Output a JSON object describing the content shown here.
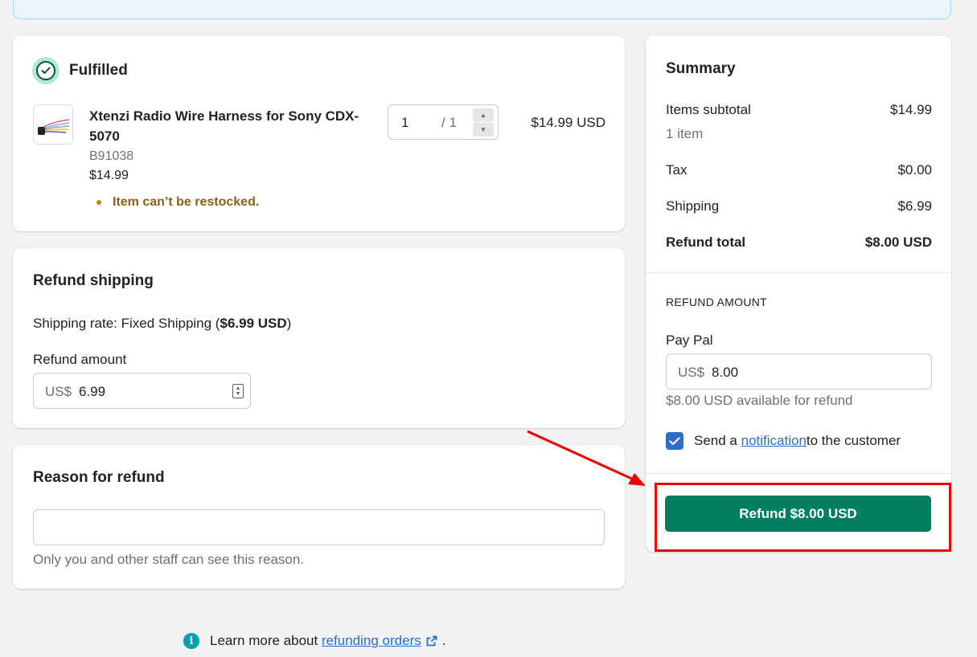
{
  "fulfilled": {
    "title": "Fulfilled",
    "item": {
      "name": "Xtenzi Radio Wire Harness for Sony CDX-5070",
      "sku": "B91038",
      "price": "$14.99",
      "quantity": "1",
      "quantity_max": "/ 1",
      "line_total": "$14.99 USD",
      "restock_note": "Item can’t be restocked."
    }
  },
  "refund_shipping": {
    "title": "Refund shipping",
    "rate_prefix": "Shipping rate: Fixed Shipping (",
    "rate_amount": "$6.99 USD",
    "rate_suffix": ")",
    "amount_label": "Refund amount",
    "currency_prefix": "US$",
    "amount_value": "6.99"
  },
  "reason": {
    "title": "Reason for refund",
    "value": "",
    "help": "Only you and other staff can see this reason."
  },
  "summary": {
    "title": "Summary",
    "items_subtotal_label": "Items subtotal",
    "items_subtotal_value": "$14.99",
    "items_count": "1 item",
    "tax_label": "Tax",
    "tax_value": "$0.00",
    "shipping_label": "Shipping",
    "shipping_value": "$6.99",
    "refund_total_label": "Refund total",
    "refund_total_value": "$8.00 USD",
    "refund_amount_heading": "REFUND AMOUNT",
    "gateway_label": "Pay Pal",
    "currency_prefix": "US$",
    "gateway_value": "8.00",
    "available_text": "$8.00 USD available for refund",
    "notify_prefix": "Send a ",
    "notify_link": "notification",
    "notify_suffix": " to the customer",
    "notify_checked": true,
    "refund_button": "Refund $8.00 USD"
  },
  "footer": {
    "prefix": "Learn more about ",
    "link": "refunding orders",
    "suffix": "."
  },
  "colors": {
    "primary_button": "#008060",
    "link": "#2c6ecb",
    "annotation": "#ee0000",
    "warning_text": "#8a6116"
  }
}
